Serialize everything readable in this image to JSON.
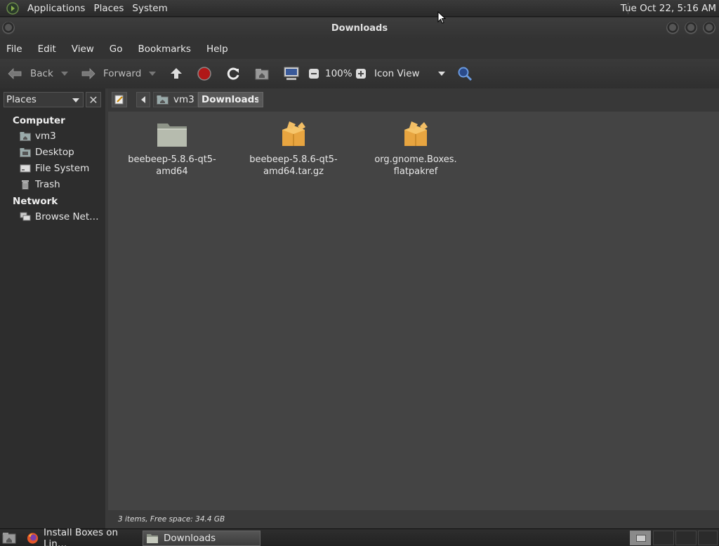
{
  "top_panel": {
    "menus": [
      "Applications",
      "Places",
      "System"
    ],
    "clock": "Tue Oct 22,  5:16 AM"
  },
  "window": {
    "title": "Downloads"
  },
  "menubar": {
    "items": [
      "File",
      "Edit",
      "View",
      "Go",
      "Bookmarks",
      "Help"
    ]
  },
  "toolbar": {
    "back": "Back",
    "forward": "Forward",
    "zoom": "100%",
    "view_mode": "Icon View"
  },
  "sidebar": {
    "selector": "Places",
    "sections": [
      {
        "heading": "Computer",
        "items": [
          "vm3",
          "Desktop",
          "File System",
          "Trash"
        ]
      },
      {
        "heading": "Network",
        "items": [
          "Browse Net…"
        ]
      }
    ]
  },
  "pathbar": {
    "crumbs": [
      "vm3",
      "Downloads"
    ]
  },
  "files": [
    {
      "name_line1": "beebeep-5.8.6-qt5-",
      "name_line2": "amd64",
      "type": "folder-icon"
    },
    {
      "name_line1": "beebeep-5.8.6-qt5-",
      "name_line2": "amd64.tar.gz",
      "type": "package-icon"
    },
    {
      "name_line1": "org.gnome.Boxes.",
      "name_line2": "flatpakref",
      "type": "package-icon"
    }
  ],
  "statusbar": {
    "text": "3 items, Free space: 34.4 GB"
  },
  "taskbar": {
    "tasks": [
      "Install Boxes on Lin…",
      "Downloads"
    ]
  }
}
